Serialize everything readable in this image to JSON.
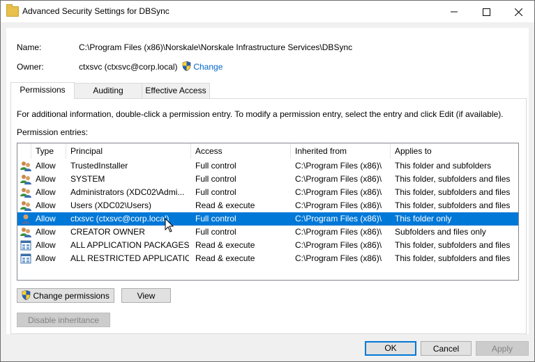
{
  "window": {
    "title": "Advanced Security Settings for DBSync"
  },
  "info": {
    "name_label": "Name:",
    "name_value": "C:\\Program Files (x86)\\Norskale\\Norskale Infrastructure Services\\DBSync",
    "owner_label": "Owner:",
    "owner_value": "ctxsvc (ctxsvc@corp.local)",
    "change_link": "Change"
  },
  "tabs": [
    {
      "label": "Permissions"
    },
    {
      "label": "Auditing"
    },
    {
      "label": "Effective Access"
    }
  ],
  "instructions": "For additional information, double-click a permission entry. To modify a permission entry, select the entry and click Edit (if available).",
  "entries_label": "Permission entries:",
  "columns": [
    "Type",
    "Principal",
    "Access",
    "Inherited from",
    "Applies to"
  ],
  "rows": [
    {
      "icon": "group-user-icon",
      "type": "Allow",
      "principal": "TrustedInstaller",
      "access": "Full control",
      "inherited": "C:\\Program Files (x86)\\",
      "applies": "This folder and subfolders"
    },
    {
      "icon": "group-user-icon",
      "type": "Allow",
      "principal": "SYSTEM",
      "access": "Full control",
      "inherited": "C:\\Program Files (x86)\\",
      "applies": "This folder, subfolders and files"
    },
    {
      "icon": "group-user-icon",
      "type": "Allow",
      "principal": "Administrators (XDC02\\Admi...",
      "access": "Full control",
      "inherited": "C:\\Program Files (x86)\\",
      "applies": "This folder, subfolders and files"
    },
    {
      "icon": "group-user-icon",
      "type": "Allow",
      "principal": "Users (XDC02\\Users)",
      "access": "Read & execute",
      "inherited": "C:\\Program Files (x86)\\",
      "applies": "This folder, subfolders and files"
    },
    {
      "icon": "single-user-icon",
      "type": "Allow",
      "principal": "ctxsvc (ctxsvc@corp.local)",
      "access": "Full control",
      "inherited": "C:\\Program Files (x86)\\",
      "applies": "This folder only",
      "selected": true
    },
    {
      "icon": "group-user-icon",
      "type": "Allow",
      "principal": "CREATOR OWNER",
      "access": "Full control",
      "inherited": "C:\\Program Files (x86)\\",
      "applies": "Subfolders and files only"
    },
    {
      "icon": "package-icon",
      "type": "Allow",
      "principal": "ALL APPLICATION PACKAGES",
      "access": "Read & execute",
      "inherited": "C:\\Program Files (x86)\\",
      "applies": "This folder, subfolders and files"
    },
    {
      "icon": "package-icon",
      "type": "Allow",
      "principal": "ALL RESTRICTED APPLICATIO...",
      "access": "Read & execute",
      "inherited": "C:\\Program Files (x86)\\",
      "applies": "This folder, subfolders and files"
    }
  ],
  "buttons": {
    "change_permissions": "Change permissions",
    "view": "View",
    "disable_inheritance": "Disable inheritance",
    "ok": "OK",
    "cancel": "Cancel",
    "apply": "Apply"
  },
  "colors": {
    "selection": "#0078d7",
    "link": "#0066cc",
    "window_bg": "#f0f0f0"
  }
}
